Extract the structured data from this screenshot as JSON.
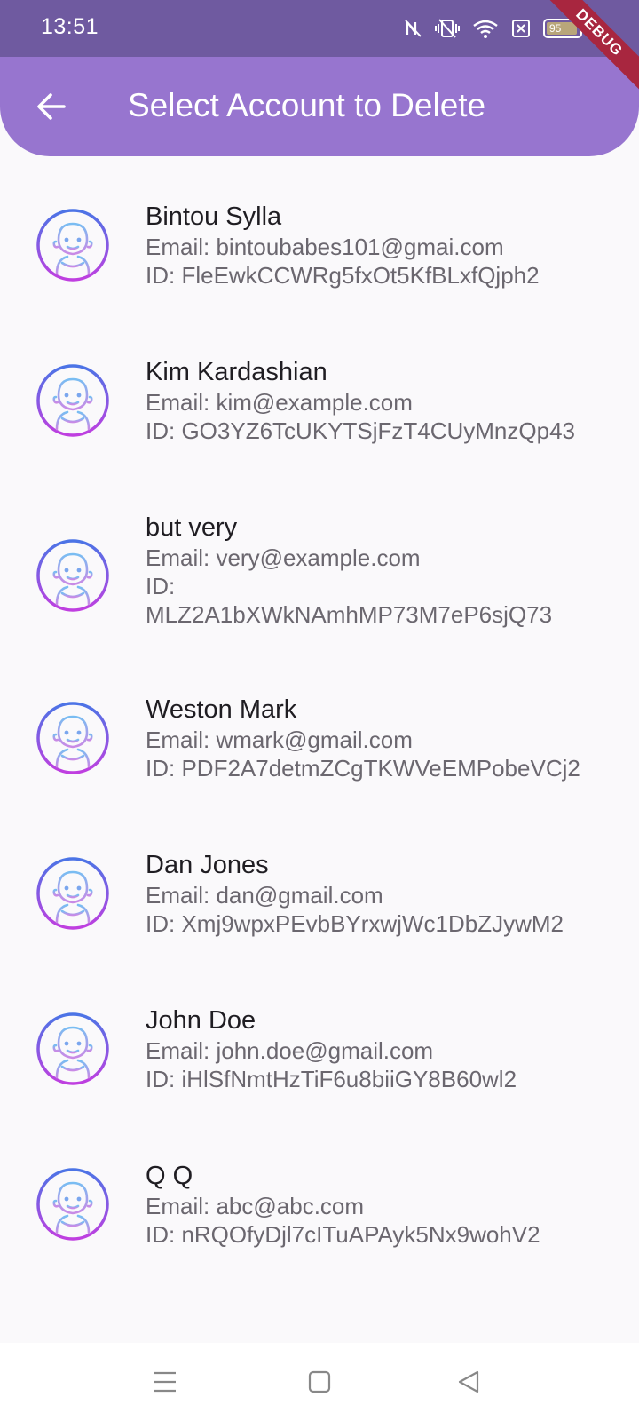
{
  "status_bar": {
    "time": "13:51",
    "battery_level": "95",
    "debug_label": "DEBUG"
  },
  "app_bar": {
    "title": "Select Account to Delete",
    "background_color": "#9775cf"
  },
  "accounts": [
    {
      "name": "Bintou Sylla",
      "email": "Email:  bintoubabes101@gmai.com",
      "id": "ID: FleEwkCCWRg5fxOt5KfBLxfQjph2"
    },
    {
      "name": "Kim Kardashian",
      "email": "Email: kim@example.com",
      "id": "ID: GO3YZ6TcUKYTSjFzT4CUyMnzQp43"
    },
    {
      "name": "but  very",
      "email": "Email: very@example.com",
      "id_label": "ID:",
      "id_value": "MLZ2A1bXWkNAmhMP73M7eP6sjQ73"
    },
    {
      "name": "Weston Mark",
      "email": "Email: wmark@gmail.com",
      "id": "ID: PDF2A7detmZCgTKWVeEMPobeVCj2"
    },
    {
      "name": "Dan Jones",
      "email": "Email: dan@gmail.com",
      "id": "ID: Xmj9wpxPEvbBYrxwjWc1DbZJywM2"
    },
    {
      "name": "John Doe",
      "email": "Email: john.doe@gmail.com",
      "id": "ID: iHlSfNmtHzTiF6u8biiGY8B60wl2"
    },
    {
      "name": "Q Q",
      "email": "Email: abc@abc.com",
      "id": "ID: nRQOfyDjl7cITuAPAyk5Nx9wohV2"
    }
  ],
  "icons": {
    "back": "arrow-back-icon",
    "avatar": "person-avatar-icon",
    "nav_menu": "menu-icon",
    "nav_home": "home-square-icon",
    "nav_back": "back-triangle-icon"
  }
}
